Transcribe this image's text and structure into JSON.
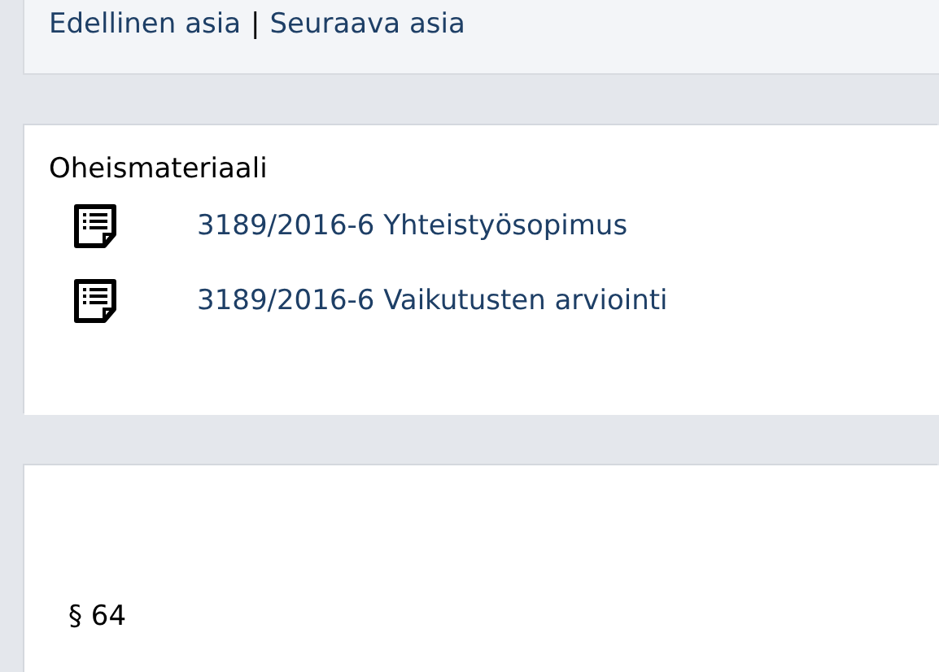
{
  "nav": {
    "previous": "Edellinen asia",
    "separator": "|",
    "next": "Seuraava asia"
  },
  "attachments": {
    "title": "Oheismateriaali",
    "items": [
      {
        "label": "3189/2016-6 Yhteistyösopimus"
      },
      {
        "label": "3189/2016-6 Vaikutusten arviointi"
      }
    ]
  },
  "section": {
    "number": "§ 64"
  }
}
